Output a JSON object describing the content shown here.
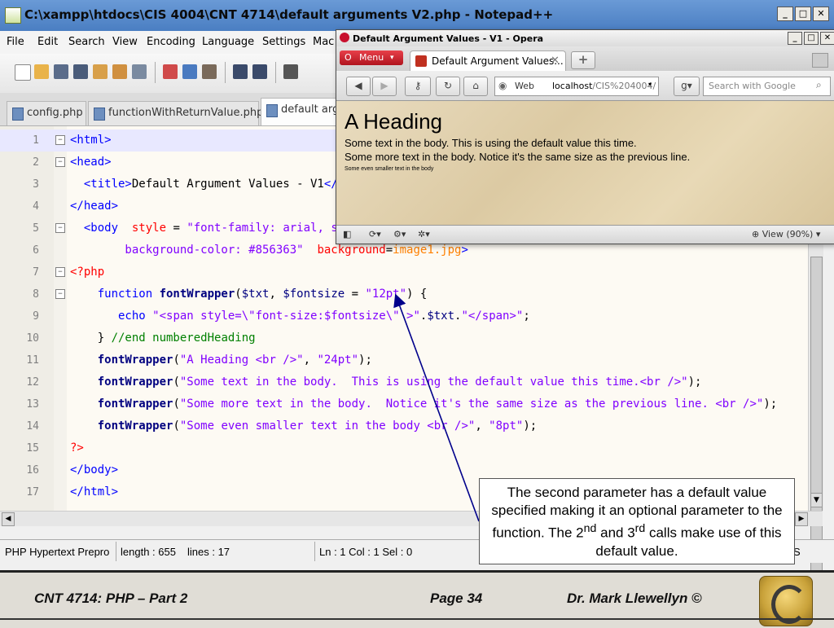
{
  "npp": {
    "title": "C:\\xampp\\htdocs\\CIS 4004\\CNT 4714\\default arguments V2.php - Notepad++",
    "menu": [
      "File",
      "Edit",
      "Search",
      "View",
      "Encoding",
      "Language",
      "Settings",
      "Mac"
    ],
    "tabs": [
      "config.php",
      "functionWithReturnValue.php",
      "default arg"
    ],
    "status": {
      "type": "PHP Hypertext Prepro",
      "length": "length : 655",
      "lines": "lines : 17",
      "pos": "Ln : 1    Col : 1    Sel : 0",
      "mode": "S"
    },
    "code": [
      {
        "n": "1",
        "parts": [
          {
            "c": "tag",
            "t": "<html>"
          }
        ]
      },
      {
        "n": "2",
        "parts": [
          {
            "c": "tag",
            "t": "<head>"
          }
        ]
      },
      {
        "n": "3",
        "parts": [
          {
            "c": "tag",
            "t": "  <title>"
          },
          {
            "c": "plain",
            "t": "Default Argument Values - V1"
          },
          {
            "c": "tag",
            "t": "</t"
          }
        ]
      },
      {
        "n": "4",
        "parts": [
          {
            "c": "tag",
            "t": "</head>"
          }
        ]
      },
      {
        "n": "5",
        "parts": [
          {
            "c": "tag",
            "t": "  <body "
          },
          {
            "c": "attr",
            "t": " style"
          },
          {
            "c": "plain",
            "t": " = "
          },
          {
            "c": "str",
            "t": "\"font-family: arial, sa"
          }
        ]
      },
      {
        "n": "6",
        "parts": [
          {
            "c": "str",
            "t": "        background-color: #856363\""
          },
          {
            "c": "plain",
            "t": "  "
          },
          {
            "c": "attr",
            "t": "background"
          },
          {
            "c": "plain",
            "t": "="
          },
          {
            "c": "orange",
            "t": "image1.jpg"
          },
          {
            "c": "tag",
            "t": ">"
          }
        ]
      },
      {
        "n": "7",
        "parts": [
          {
            "c": "php",
            "t": "<?php"
          }
        ]
      },
      {
        "n": "8",
        "parts": [
          {
            "c": "kw",
            "t": "    function "
          },
          {
            "c": "fn",
            "t": "fontWrapper"
          },
          {
            "c": "plain",
            "t": "("
          },
          {
            "c": "var",
            "t": "$txt"
          },
          {
            "c": "plain",
            "t": ", "
          },
          {
            "c": "var",
            "t": "$fontsize"
          },
          {
            "c": "plain",
            "t": " = "
          },
          {
            "c": "str",
            "t": "\"12pt\""
          },
          {
            "c": "plain",
            "t": ") {"
          }
        ]
      },
      {
        "n": "9",
        "parts": [
          {
            "c": "kw",
            "t": "       echo "
          },
          {
            "c": "str",
            "t": "\"<span style=\\\"font-size:$fontsize\\\" >\""
          },
          {
            "c": "plain",
            "t": "."
          },
          {
            "c": "var",
            "t": "$txt"
          },
          {
            "c": "plain",
            "t": "."
          },
          {
            "c": "str",
            "t": "\"</span>\""
          },
          {
            "c": "plain",
            "t": ";"
          }
        ]
      },
      {
        "n": "10",
        "parts": [
          {
            "c": "plain",
            "t": "    } "
          },
          {
            "c": "cm",
            "t": "//end numberedHeading"
          }
        ]
      },
      {
        "n": "11",
        "parts": [
          {
            "c": "fn",
            "t": "    fontWrapper"
          },
          {
            "c": "plain",
            "t": "("
          },
          {
            "c": "str",
            "t": "\"A Heading <br />\""
          },
          {
            "c": "plain",
            "t": ", "
          },
          {
            "c": "str",
            "t": "\"24pt\""
          },
          {
            "c": "plain",
            "t": ");"
          }
        ]
      },
      {
        "n": "12",
        "parts": [
          {
            "c": "fn",
            "t": "    fontWrapper"
          },
          {
            "c": "plain",
            "t": "("
          },
          {
            "c": "str",
            "t": "\"Some text in the body.  This is using the default value this time.<br />\""
          },
          {
            "c": "plain",
            "t": ");"
          }
        ]
      },
      {
        "n": "13",
        "parts": [
          {
            "c": "fn",
            "t": "    fontWrapper"
          },
          {
            "c": "plain",
            "t": "("
          },
          {
            "c": "str",
            "t": "\"Some more text in the body.  Notice it's the same size as the previous line. <br />\""
          },
          {
            "c": "plain",
            "t": ");"
          }
        ]
      },
      {
        "n": "14",
        "parts": [
          {
            "c": "fn",
            "t": "    fontWrapper"
          },
          {
            "c": "plain",
            "t": "("
          },
          {
            "c": "str",
            "t": "\"Some even smaller text in the body <br />\""
          },
          {
            "c": "plain",
            "t": ", "
          },
          {
            "c": "str",
            "t": "\"8pt\""
          },
          {
            "c": "plain",
            "t": ");"
          }
        ]
      },
      {
        "n": "15",
        "parts": [
          {
            "c": "php",
            "t": "?>"
          }
        ]
      },
      {
        "n": "16",
        "parts": [
          {
            "c": "tag",
            "t": "</body>"
          }
        ]
      },
      {
        "n": "17",
        "parts": [
          {
            "c": "tag",
            "t": "</html>"
          }
        ]
      }
    ]
  },
  "opera": {
    "title": "Default Argument Values - V1 - Opera",
    "menu_label": "Menu",
    "tab_label": "Default Argument Values...",
    "addr_label": "Web",
    "addr_host": "localhost",
    "addr_path": "/CIS%204004/",
    "search_placeholder": "Search with Google",
    "content": {
      "heading": "A Heading",
      "line1": "Some text in the body. This is using the default value this time.",
      "line2": "Some more text in the body. Notice it's the same size as the previous line.",
      "line3": "Some even smaller text in the body"
    },
    "zoom": "View (90%)"
  },
  "callout": {
    "text_a": "The second parameter has a default value specified making it an optional parameter to the function.  The 2",
    "sup1": "nd",
    "text_b": " and 3",
    "sup2": "rd",
    "text_c": " calls make use of this default value."
  },
  "footer": {
    "course": "CNT 4714:  PHP – Part 2",
    "page": "Page 34",
    "author": "Dr. Mark Llewellyn ©"
  }
}
